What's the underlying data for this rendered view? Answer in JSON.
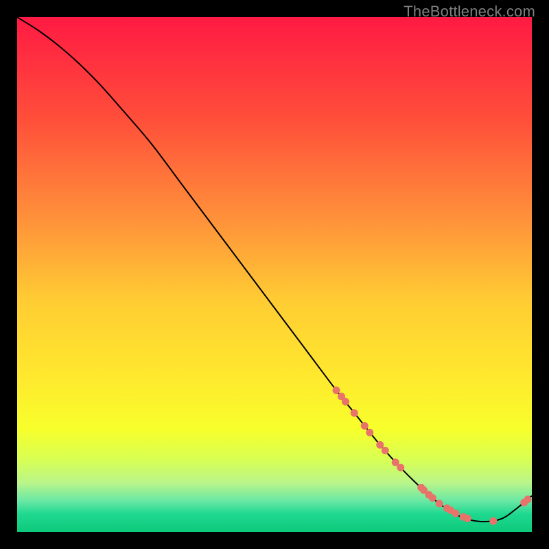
{
  "attribution": "TheBottleneck.com",
  "chart_data": {
    "type": "line",
    "title": "",
    "xlabel": "",
    "ylabel": "",
    "xlim": [
      0,
      100
    ],
    "ylim": [
      0,
      100
    ],
    "grid": false,
    "legend": false,
    "gradient_stops": [
      {
        "offset": 0.0,
        "color": "#ff1a43"
      },
      {
        "offset": 0.2,
        "color": "#ff4f3a"
      },
      {
        "offset": 0.4,
        "color": "#ff943a"
      },
      {
        "offset": 0.55,
        "color": "#ffcc33"
      },
      {
        "offset": 0.7,
        "color": "#ffe92e"
      },
      {
        "offset": 0.8,
        "color": "#f7ff2b"
      },
      {
        "offset": 0.86,
        "color": "#d8ff54"
      },
      {
        "offset": 0.905,
        "color": "#b9f58a"
      },
      {
        "offset": 0.94,
        "color": "#69e8a5"
      },
      {
        "offset": 0.965,
        "color": "#1fd990"
      },
      {
        "offset": 1.0,
        "color": "#0dc97b"
      }
    ],
    "series": [
      {
        "name": "bottleneck-curve",
        "color": "#000000",
        "x": [
          0,
          4,
          8,
          12,
          16,
          20,
          26,
          32,
          38,
          44,
          50,
          56,
          62,
          66,
          70,
          74,
          78,
          82,
          86,
          90,
          94,
          97,
          100
        ],
        "y": [
          100,
          97.5,
          94.5,
          91,
          87,
          82.5,
          75.5,
          67.5,
          59.5,
          51.5,
          43.5,
          35.5,
          27.5,
          22.5,
          17.5,
          13,
          9,
          5.5,
          3,
          2,
          2.5,
          4.5,
          7
        ]
      }
    ],
    "markers": {
      "name": "highlight-points",
      "color": "#e8736a",
      "radius_px": 5.5,
      "points": [
        {
          "x": 62.0,
          "y": 27.5
        },
        {
          "x": 63.0,
          "y": 26.3
        },
        {
          "x": 63.8,
          "y": 25.3
        },
        {
          "x": 65.5,
          "y": 23.1
        },
        {
          "x": 67.5,
          "y": 20.6
        },
        {
          "x": 68.5,
          "y": 19.3
        },
        {
          "x": 70.5,
          "y": 16.9
        },
        {
          "x": 71.5,
          "y": 15.8
        },
        {
          "x": 73.5,
          "y": 13.5
        },
        {
          "x": 74.5,
          "y": 12.5
        },
        {
          "x": 78.5,
          "y": 8.6
        },
        {
          "x": 79.0,
          "y": 8.1
        },
        {
          "x": 80.0,
          "y": 7.2
        },
        {
          "x": 80.7,
          "y": 6.6
        },
        {
          "x": 82.0,
          "y": 5.5
        },
        {
          "x": 83.5,
          "y": 4.6
        },
        {
          "x": 84.2,
          "y": 4.2
        },
        {
          "x": 85.2,
          "y": 3.6
        },
        {
          "x": 86.7,
          "y": 2.9
        },
        {
          "x": 87.5,
          "y": 2.6
        },
        {
          "x": 92.5,
          "y": 2.1
        },
        {
          "x": 98.5,
          "y": 5.7
        },
        {
          "x": 99.2,
          "y": 6.3
        }
      ]
    }
  }
}
